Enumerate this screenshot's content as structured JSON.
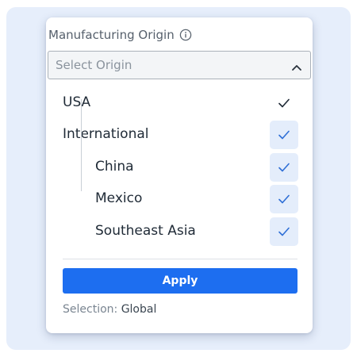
{
  "field": {
    "label": "Manufacturing Origin",
    "info_icon": "info-circle-icon"
  },
  "select": {
    "placeholder": "Select Origin",
    "expanded": true,
    "chevron_icon": "chevron-up-icon"
  },
  "options": [
    {
      "label": "USA",
      "checked": true,
      "level": 0
    },
    {
      "label": "International",
      "checked": true,
      "level": 0
    },
    {
      "label": "China",
      "checked": true,
      "level": 1
    },
    {
      "label": "Mexico",
      "checked": true,
      "level": 1
    },
    {
      "label": "Southeast Asia",
      "checked": true,
      "level": 1
    }
  ],
  "apply_label": "Apply",
  "selection": {
    "prefix": "Selection:",
    "value": "Global"
  },
  "colors": {
    "accent": "#1d6ef0",
    "background": "#e6eefb",
    "check_tint": "#e4edfb"
  }
}
